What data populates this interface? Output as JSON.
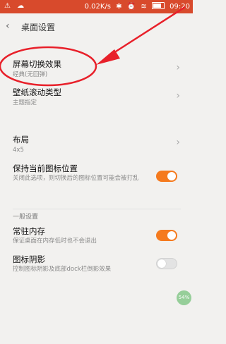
{
  "status_bar": {
    "speed": "0.02K/s",
    "time": "09:20"
  },
  "header": {
    "title": "桌面设置"
  },
  "items": [
    {
      "title": "屏幕切换效果",
      "subtitle": "经典(无回弹)"
    },
    {
      "title": "壁纸滚动类型",
      "subtitle": "主题指定"
    },
    {
      "title": "布局",
      "subtitle": "4x5"
    },
    {
      "title": "保持当前图标位置",
      "subtitle": "关闭此选项，则切换后的图标位置可能会被打乱",
      "toggle": "on"
    }
  ],
  "section": {
    "header": "一般设置",
    "items": [
      {
        "title": "常驻内存",
        "subtitle": "保证桌面在内存低时也不会退出",
        "toggle": "on"
      },
      {
        "title": "图标阴影",
        "subtitle": "控制图标阴影及底部dock栏倒影效果",
        "toggle": "off"
      }
    ]
  },
  "floating_badge": "54%",
  "colors": {
    "status_bar": "#d84a2c",
    "toggle_on": "#f57a1e",
    "annotation": "#e8202a"
  }
}
